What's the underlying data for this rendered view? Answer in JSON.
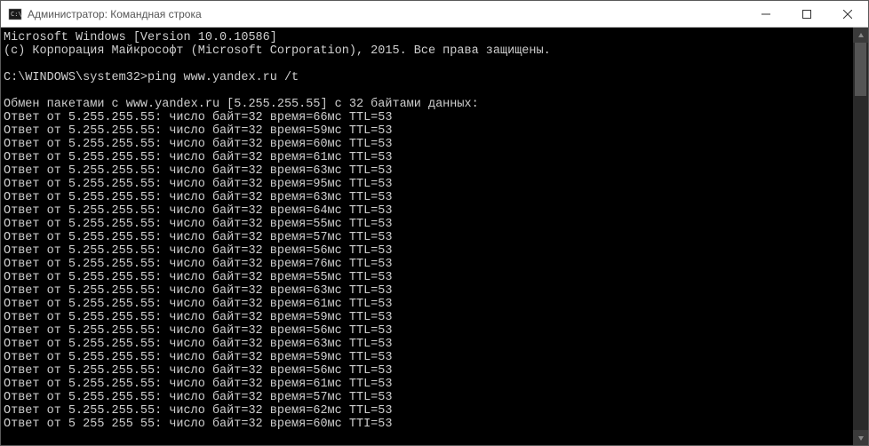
{
  "window": {
    "title": "Администратор: Командная строка"
  },
  "terminal": {
    "header1": "Microsoft Windows [Version 10.0.10586]",
    "header2": "(c) Корпорация Майкрософт (Microsoft Corporation), 2015. Все права защищены.",
    "prompt_line": "C:\\WINDOWS\\system32>ping www.yandex.ru /t",
    "exchange_line": "Обмен пакетами с www.yandex.ru [5.255.255.55] с 32 байтами данных:",
    "reply_prefix": "Ответ от 5.255.255.55: число байт=32 время=",
    "reply_suffix_ttl": "мс TTL=53",
    "last_partial": "Ответ от 5 255 255 55: число байт=32 время=60мс TTI=53",
    "ping_times_ms": [
      66,
      59,
      60,
      61,
      63,
      95,
      63,
      64,
      55,
      57,
      56,
      76,
      55,
      63,
      61,
      59,
      56,
      63,
      59,
      56,
      61,
      57,
      62
    ]
  }
}
